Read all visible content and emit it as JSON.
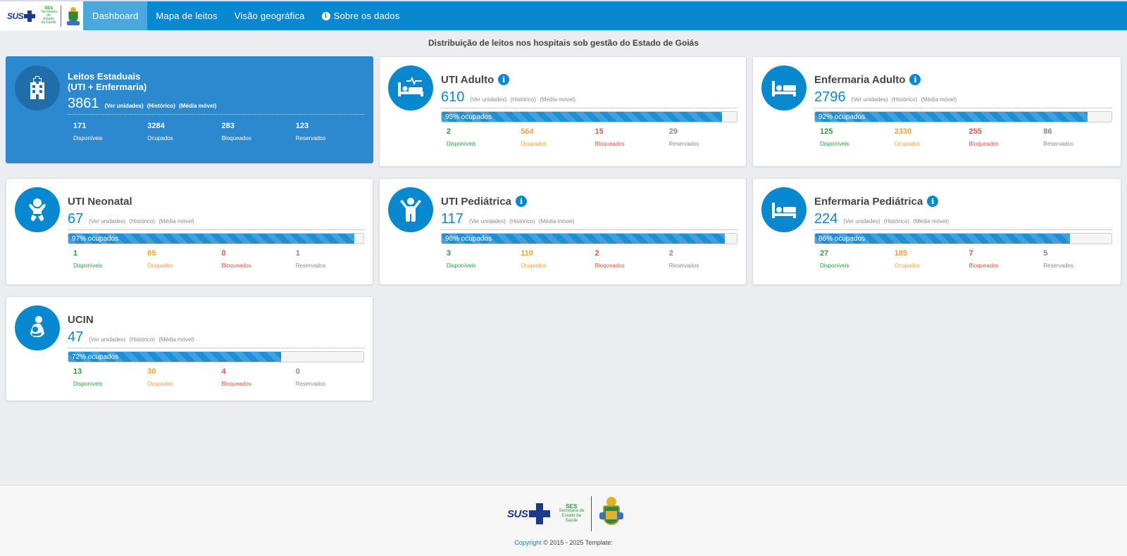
{
  "nav": {
    "items": [
      {
        "label": "Dashboard",
        "active": true
      },
      {
        "label": "Mapa de leitos"
      },
      {
        "label": "Visão geográfica"
      },
      {
        "label": "Sobre os dados",
        "icon": "info-icon"
      }
    ],
    "logo_text": "SUS",
    "ses_text": "SES",
    "ses_sub": "Secretaria de Estado da Saúde"
  },
  "page_title": "Distribuição de leitos nos hospitais sob gestão do Estado de Goiás",
  "links": {
    "units": "(Ver unidades)",
    "history": "(Histórico)",
    "moving_avg": "(Média móvel)"
  },
  "stat_labels": {
    "available": "Disponíveis",
    "occupied": "Ocupados",
    "blocked": "Bloqueados",
    "reserved": "Reservados"
  },
  "colors": {
    "primary": "#0888cf",
    "available": "#2e9a3e",
    "occupied": "#f0a13a",
    "blocked": "#e4533f",
    "reserved": "#888888"
  },
  "cards": [
    {
      "title_line1": "Leitos Estaduais",
      "title_line2": "(UTI + Enfermaria)",
      "icon": "hospital-building-icon",
      "total": "3861",
      "available": "171",
      "occupied": "3284",
      "blocked": "283",
      "reserved": "123"
    },
    {
      "title": "UTI Adulto",
      "icon": "icu-bed-icon",
      "info": true,
      "total": "610",
      "occupancy": 95,
      "occupancy_label": "95% ocupados",
      "available": "2",
      "occupied": "564",
      "blocked": "15",
      "reserved": "29"
    },
    {
      "title": "Enfermaria Adulto",
      "icon": "bed-icon",
      "info": true,
      "total": "2796",
      "occupancy": 92,
      "occupancy_label": "92% ocupados",
      "available": "125",
      "occupied": "2330",
      "blocked": "255",
      "reserved": "86"
    },
    {
      "title": "UTI Neonatal",
      "icon": "baby-icon",
      "info": false,
      "total": "67",
      "occupancy": 97,
      "occupancy_label": "97% ocupados",
      "available": "1",
      "occupied": "65",
      "blocked": "0",
      "reserved": "1"
    },
    {
      "title": "UTI Pediátrica",
      "icon": "child-icon",
      "info": true,
      "total": "117",
      "occupancy": 96,
      "occupancy_label": "96% ocupados",
      "available": "3",
      "occupied": "110",
      "blocked": "2",
      "reserved": "2"
    },
    {
      "title": "Enfermaria Pediátrica",
      "icon": "bed-icon",
      "info": true,
      "total": "224",
      "occupancy": 86,
      "occupancy_label": "86% ocupados",
      "available": "27",
      "occupied": "185",
      "blocked": "7",
      "reserved": "5"
    },
    {
      "title": "UCIN",
      "icon": "mother-baby-icon",
      "info": false,
      "total": "47",
      "occupancy": 72,
      "occupancy_label": "72% ocupados",
      "available": "13",
      "occupied": "30",
      "blocked": "4",
      "reserved": "0"
    }
  ],
  "footer": {
    "logo_text": "SUS",
    "ses_text": "SES",
    "ses_sub": "Secretaria de Estado da Saúde",
    "copyright_link": "Copyright",
    "copyright_text": "© 2015 - 2025 Template:"
  }
}
